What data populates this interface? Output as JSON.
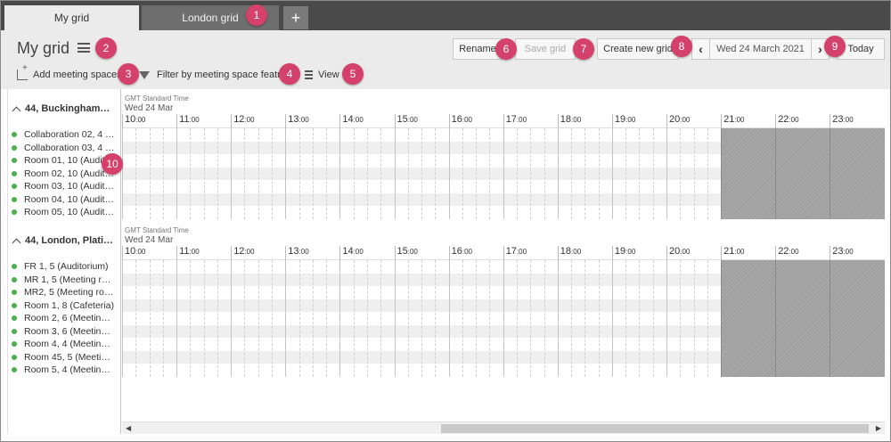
{
  "tabs": [
    {
      "label": "My grid",
      "active": true
    },
    {
      "label": "London grid",
      "active": false
    }
  ],
  "add_tab_label": "+",
  "grid_title": "My grid",
  "toolbar": {
    "add_spaces_label": "Add meeting spaces",
    "filter_label": "Filter by meeting space feature",
    "view_label": "View",
    "rename_label": "Rename",
    "save_label": "Save grid",
    "create_label": "Create new grid",
    "prev_label": "‹",
    "date_label": "Wed 24 March 2021",
    "next_label": "›",
    "today_label": "Today"
  },
  "badges": [
    "1",
    "2",
    "3",
    "4",
    "5",
    "6",
    "7",
    "8",
    "9",
    "10"
  ],
  "groups": [
    {
      "name": "44, Buckingham…",
      "timezone": "GMT Standard Time",
      "date": "Wed 24 Mar",
      "rooms": [
        "Collaboration 02, 4 …",
        "Collaboration 03, 4 …",
        "Room 01, 10 (Audit…",
        "Room 02, 10 (Audit…",
        "Room 03, 10 (Audit…",
        "Room 04, 10 (Audit…",
        "Room 05, 10 (Audit…"
      ]
    },
    {
      "name": "44, London, Plati…",
      "timezone": "GMT Standard Time",
      "date": "Wed 24 Mar",
      "rooms": [
        "FR 1, 5 (Auditorium)",
        "MR 1, 5 (Meeting r…",
        "MR2, 5 (Meeting ro…",
        "Room 1, 8 (Cafeteria)",
        "Room 2, 6 (Meetin…",
        "Room 3, 6 (Meetin…",
        "Room 4, 4 (Meetin…",
        "Room 45, 5 (Meeti…",
        "Room 5, 4 (Meetin…"
      ]
    }
  ],
  "hours": [
    "10",
    "11",
    "12",
    "13",
    "14",
    "15",
    "16",
    "17",
    "18",
    "19",
    "20",
    "21",
    "22",
    "23"
  ],
  "minutes_suffix": ":00",
  "colors": {
    "badge": "#d4416a",
    "status_dot": "#4caf50",
    "tabbar": "#4a4a4a"
  }
}
